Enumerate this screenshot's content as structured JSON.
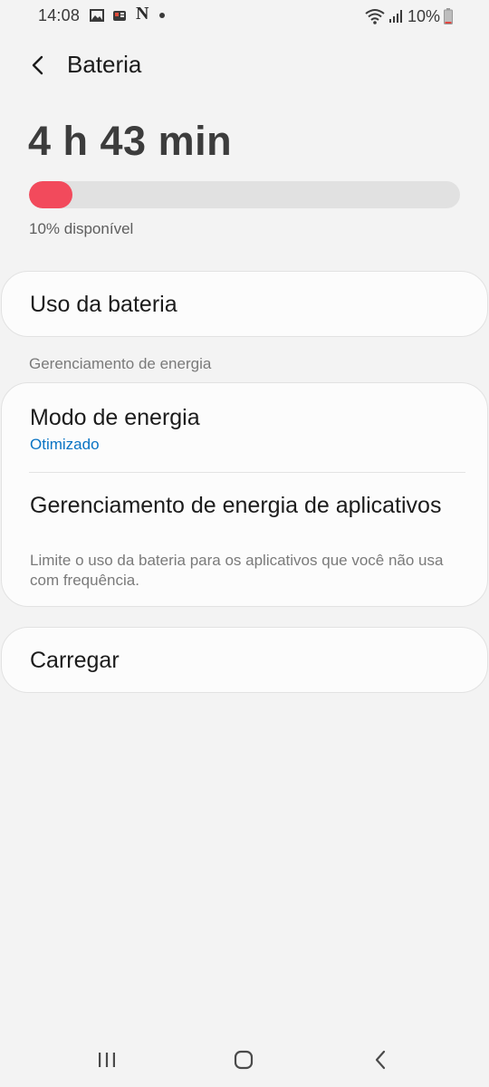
{
  "status_bar": {
    "time": "14:08",
    "notifications": [
      "gallery-icon",
      "app-notification-icon",
      "netflix-icon",
      "more-dot-icon"
    ],
    "netflix_letter": "N",
    "battery_percent": "10%"
  },
  "header": {
    "title": "Bateria"
  },
  "battery": {
    "time_remaining": "4 h 43 min",
    "level_fraction": 0.1,
    "available_text": "10% disponível",
    "bar_fill_color": "#f24a5c"
  },
  "menu": {
    "battery_usage": "Uso da bateria",
    "section_header": "Gerenciamento de energia",
    "power_mode": {
      "title": "Modo de energia",
      "value": "Otimizado"
    },
    "app_power_management": {
      "title": "Gerenciamento de energia de aplicativos",
      "description": "Limite o uso da bateria para os aplicativos que você não usa com frequência."
    },
    "charging": "Carregar"
  },
  "nav_bar": {
    "icons": [
      "recents-icon",
      "home-icon",
      "back-icon"
    ]
  },
  "colors": {
    "accent": "#0a74c4",
    "battery_low": "#f24a5c",
    "background": "#f3f3f3",
    "card": "#fcfcfc"
  }
}
